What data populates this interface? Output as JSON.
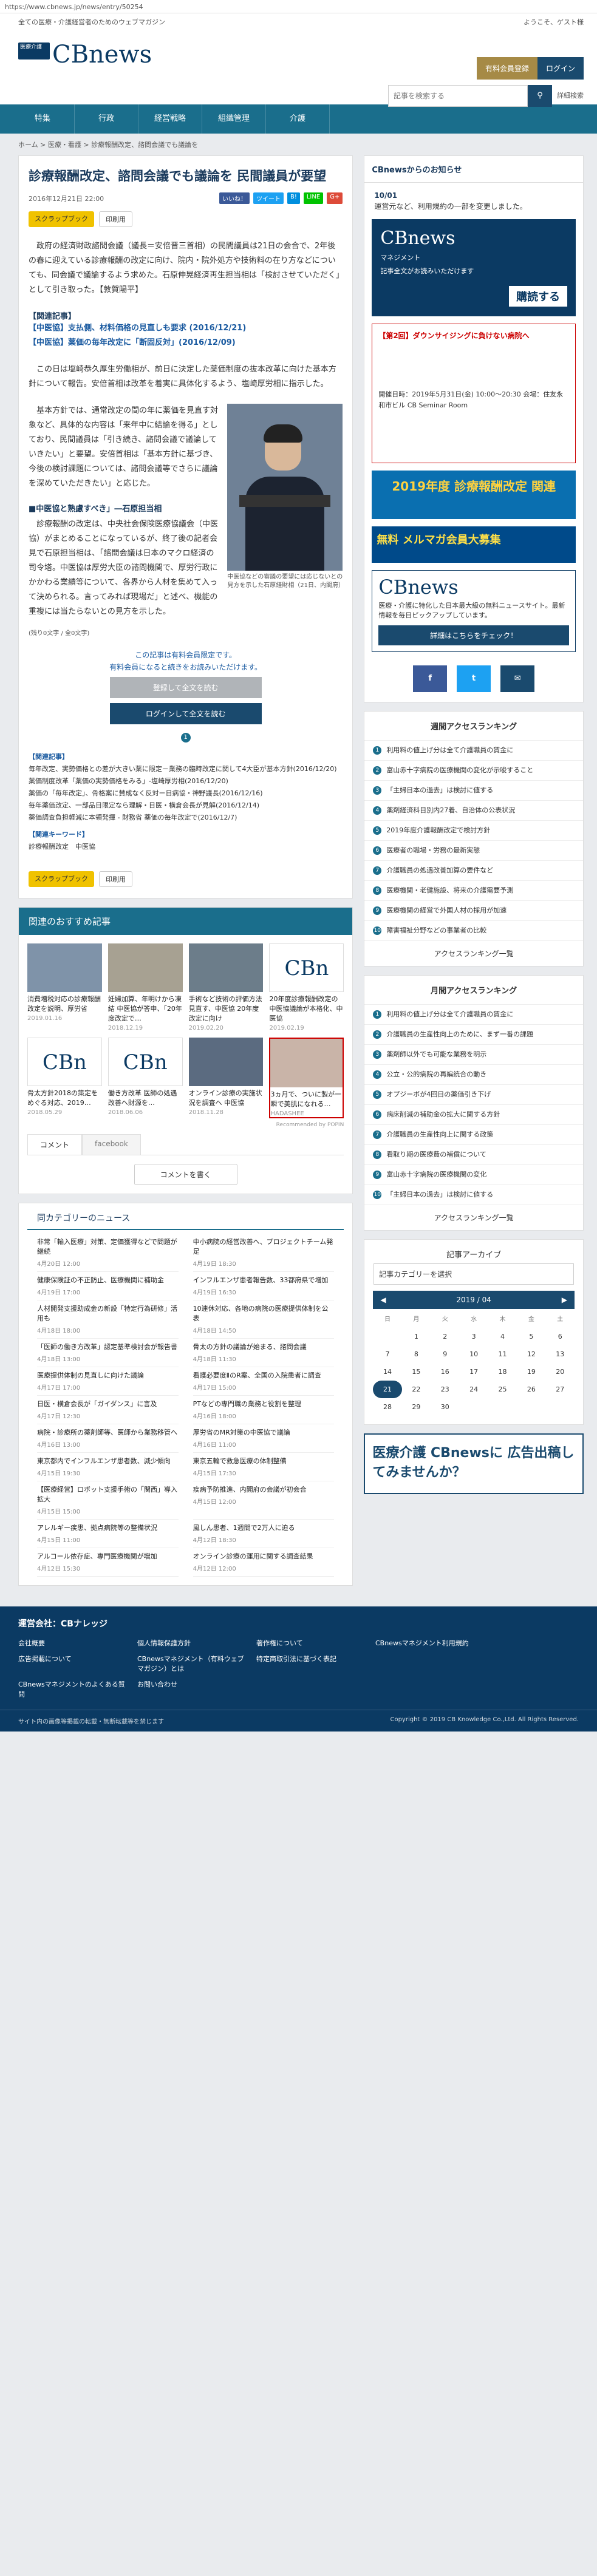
{
  "url": "https://www.cbnews.jp/news/entry/50254",
  "header": {
    "tagline": "全ての医療・介護経営者のためのウェブマガジン",
    "welcome": "ようこそ、ゲスト様",
    "logo_badge": "医療介護",
    "logo_text": "CBnews",
    "logo_sub": "マネジメント",
    "btn_paid": "有料会員登録",
    "btn_login": "ログイン"
  },
  "search": {
    "placeholder": "記事を検索する",
    "btn": "検索",
    "advanced": "詳細検索"
  },
  "nav": [
    "特集",
    "行政",
    "経営戦略",
    "組織管理",
    "介護"
  ],
  "breadcrumb": "ホーム > 医療・看護 > 診療報酬改定、諮問会議でも議論を",
  "article": {
    "title": "診療報酬改定、諮問会議でも議論を 民間議員が要望",
    "date": "2016年12月21日 22:00",
    "shares": [
      "いいね！",
      "ツイート",
      "B!",
      "LINE",
      "G+"
    ],
    "scrap": "スクラップブック",
    "print": "印刷用",
    "p1": "政府の経済財政諮問会議（議長＝安倍晋三首相）の民間議員は21日の会合で、2年後の春に迎えている診療報酬の改定に向け、院内・院外処方や技術料の在り方などについても、同会議で議論するよう求めた。石原伸晃経済再生担当相は「検討させていただく」として引き取った。【敦賀陽平】",
    "rel_head": "【関連記事】",
    "rel1": "【中医協】支払側、材料価格の見直しも要求 (2016/12/21)",
    "rel2": "【中医協】薬価の毎年改定に「断固反対」(2016/12/09)",
    "p2": "この日は塩崎恭久厚生労働相が、前日に決定した薬価制度の抜本改革に向けた基本方針について報告。安倍首相は改革を着実に具体化するよう、塩崎厚労相に指示した。",
    "p3": "基本方針では、通常改定の間の年に薬価を見直す対象など、具体的な内容は「来年中に結論を得る」としており、民間議員は「引き続き、諮問会議で議論していきたい」と要望。安倍首相は「基本方針に基づき、今後の検討課題については、諮問会議等でさらに議論を深めていただきたい」と応じた。",
    "fig_cap": "中医協などの審議の要望には応じないとの見方を示した石原経財相（21日、内閣府）",
    "sub": "■中医協と熟慮すべき」―石原担当相",
    "p4": "診療報酬の改定は、中央社会保険医療協議会（中医協）がまとめることになっているが、終了後の記者会見で石原担当相は、「諮問会議は日本のマクロ経済の司令塔。中医協は厚労大臣の諮問機関で、厚労行政にかかわる業績等について、各界から人材を集めて入って決められる。言ってみれば現場だ」と述べ、機能の重複には当たらないとの見方を示した。",
    "remain": "(残り0文字 / 全0文字)",
    "pay1": "この記事は有料会員限定です。",
    "pay2": "有料会員になると続きをお読みいただけます。",
    "pay_btn1": "登録して全文を読む",
    "pay_btn2": "ログインして全文を読む",
    "page": "1",
    "links_head": "【関連記事】",
    "links": [
      "毎年改定、実勢価格との差が大きい薬に限定－業務の臨時改定に関して4大臣が基本方針(2016/12/20)",
      "薬価制度改革「薬価の実勢価格をみる」-塩崎厚労相(2016/12/20)",
      "薬価の「毎年改定」、骨格案に賛成なく反対ー日病協・神野議長(2016/12/16)",
      "毎年薬価改定、一部品目限定なら理解・日医・横倉会長が見解(2016/12/14)",
      "薬価調査負担軽減に本領発揮 - 財務省 薬価の毎年改定で(2016/12/7)"
    ],
    "kw_head": "【関連キーワード】",
    "kw": "診療報酬改定　中医協"
  },
  "reco": {
    "head": "関連のおすすめ記事",
    "items": [
      {
        "t": "消費増税対応の診療報酬改定を説明、厚労省",
        "d": "2019.01.16"
      },
      {
        "t": "妊婦加算、年明けから凍結 中医協が答申、「20年度改定で…",
        "d": "2018.12.19"
      },
      {
        "t": "手術など技術の評価方法見直す、中医協 20年度改定に向け",
        "d": "2019.02.20"
      },
      {
        "t": "20年度診療報酬改定の中医協議論が本格化、中医協",
        "d": "2019.02.19"
      },
      {
        "t": "骨太方針2018の策定をめぐる対応、2019…",
        "d": "2018.05.29"
      },
      {
        "t": "働き方改革 医師の処遇改善へ財源を…",
        "d": "2018.06.06"
      },
      {
        "t": "オンライン診療の実施状況を調査へ 中医協",
        "d": "2018.11.28"
      },
      {
        "t": "3ヵ月で、ついに製が一瞬で美肌になれる…",
        "d": "HADASHEE"
      }
    ],
    "popin": "Recommended by  POPIN"
  },
  "tabs": {
    "comment": "コメント",
    "facebook": "facebook"
  },
  "cmt_btn": "コメントを書く",
  "catnews": {
    "head": "同カテゴリーのニュース",
    "items": [
      {
        "t": "非常「輸入医療」対策、定価獲得などで問題が継続",
        "d": "4月20日 12:00"
      },
      {
        "t": "中小病院の経営改善へ、プロジェクトチーム発足",
        "d": "4月19日 18:30"
      },
      {
        "t": "健康保険証の不正防止、医療機関に補助金",
        "d": "4月19日 17:00"
      },
      {
        "t": "インフルエンザ患者報告数、33都府県で増加",
        "d": "4月19日 16:30"
      },
      {
        "t": "人材開発支援助成金の新設「特定行為研修」活用も",
        "d": "4月18日 18:00"
      },
      {
        "t": "10連休対応、各地の病院の医療提供体制を公表",
        "d": "4月18日 14:50"
      },
      {
        "t": "「医師の働き方改革」認定基準検討会が報告書",
        "d": "4月18日 13:00"
      },
      {
        "t": "骨太の方針の議論が始まる、諮問会議",
        "d": "4月18日 11:30"
      },
      {
        "t": "医療提供体制の見直しに向けた議論",
        "d": "4月17日 17:00"
      },
      {
        "t": "看護必要度ⅡのR案、全国の入院患者に調査",
        "d": "4月17日 15:00"
      },
      {
        "t": "日医・横倉会長が「ガイダンス」に言及",
        "d": "4月17日 12:30"
      },
      {
        "t": "PTなどの専門職の業務と役割を整理",
        "d": "4月16日 18:00"
      },
      {
        "t": "病院・診療所の薬剤師等、医師から業務移管へ",
        "d": "4月16日 13:00"
      },
      {
        "t": "厚労省のMR対策の中医協で議論",
        "d": "4月16日 11:00"
      },
      {
        "t": "東京都内でインフルエンザ患者数、減少傾向",
        "d": "4月15日 19:30"
      },
      {
        "t": "東京五輪で救急医療の体制整備",
        "d": "4月15日 17:30"
      },
      {
        "t": "【医療経営】ロボット支援手術の「関西」導入拡大",
        "d": "4月15日 15:00"
      },
      {
        "t": "疾病予防推進、内閣府の会議が初会合",
        "d": "4月15日 12:00"
      },
      {
        "t": "アレルギー疾患、拠点病院等の整備状況",
        "d": "4月15日 11:00"
      },
      {
        "t": "風しん患者、1週間で2万人に迫る",
        "d": "4月12日 18:30"
      },
      {
        "t": "アルコール依存症、専門医療機関が増加",
        "d": "4月12日 15:30"
      },
      {
        "t": "オンライン診療の運用に関する調査結果",
        "d": "4月12日 12:00"
      }
    ]
  },
  "side": {
    "notice_head": "CBnewsからのお知らせ",
    "notice_date": "10/01",
    "notice_text": "運営元など、利用規約の一部を変更しました。",
    "ad1_title": "CBnews",
    "ad1_sub": "マネジメント",
    "ad1_text": "記事全文がお読みいただけます",
    "ad1_btn": "購読する",
    "ad2_title": "【第2回】ダウンサイジングに負けない病院へ",
    "ad2_body": "開催日時：2019年5月31日(金) 10:00〜20:30 会場：住友永和市ビル CB Seminar Room",
    "ad3": "2019年度 診療報酬改定 関連",
    "ad4_title": "無料 メルマガ会員大募集",
    "cbn_text": "医療・介護に特化した日本最大級の無料ニュースサイト。最新情報を毎日ピックアップしています。",
    "cbn_btn": "詳細はこちらをチェック！",
    "rank_head": "週間アクセスランキング",
    "rank": [
      "利用料の値上げ分は全て介護職員の賃金に",
      "富山赤十字病院の医療機関の変化が示唆すること",
      "「主婦日本の過去」は検討に値する",
      "薬剤経済科目別内27着、自治体の公表状況",
      "2019年度介護報酬改定で検討方針",
      "医療者の職場・労務の最新実態",
      "介護職員の処遇改善加算の要件など",
      "医療機関・老健施設、将来の介護需要予測",
      "医療機関の経営で外国人材の採用が加速",
      "障害福祉分野などの事業者の比較"
    ],
    "rank_more": "アクセスランキング一覧",
    "mrank_head": "月間アクセスランキング",
    "mrank": [
      "利用料の値上げ分は全て介護職員の賃金に",
      "介護職員の生産性向上のために、まず一番の課題",
      "薬剤師以外でも可能な業務を明示",
      "公立・公的病院の再編統合の動き",
      "オプジーボが4回目の薬価引き下げ",
      "病床削減の補助金の拡大に関する方針",
      "介護職員の生産性向上に関する政策",
      "看取り期の医療費の補償について",
      "富山赤十字病院の医療機関の変化",
      "「主婦日本の過去」は検討に値する"
    ],
    "mrank_more": "アクセスランキング一覧",
    "arch_head": "記事アーカイブ",
    "arch_sel": "記事カテゴリーを選択",
    "cal_month": "2019 / 04",
    "dows": [
      "日",
      "月",
      "火",
      "水",
      "木",
      "金",
      "土"
    ],
    "days": [
      "",
      "1",
      "2",
      "3",
      "4",
      "5",
      "6",
      "7",
      "8",
      "9",
      "10",
      "11",
      "12",
      "13",
      "14",
      "15",
      "16",
      "17",
      "18",
      "19",
      "20",
      "21",
      "22",
      "23",
      "24",
      "25",
      "26",
      "27",
      "28",
      "29",
      "30",
      "",
      "",
      "",
      ""
    ],
    "ad5": "医療介護 CBnewsに 広告出稿してみませんか？"
  },
  "footer": {
    "company": "運営会社：CBナレッジ",
    "links": [
      "会社概要",
      "個人情報保護方針",
      "著作権について",
      "CBnewsマネジメント利用規約",
      "広告掲載について",
      "CBnewsマネジメント（有料ウェブマガジン）とは",
      "特定商取引法に基づく表記",
      "",
      "CBnewsマネジメントのよくある質問",
      "お問い合わせ",
      "",
      ""
    ],
    "left": "サイト内の画像等掲載の転載・無断転載等を禁じます",
    "copy": "Copyright © 2019 CB Knowledge Co.,Ltd. All Rights Reserved."
  }
}
